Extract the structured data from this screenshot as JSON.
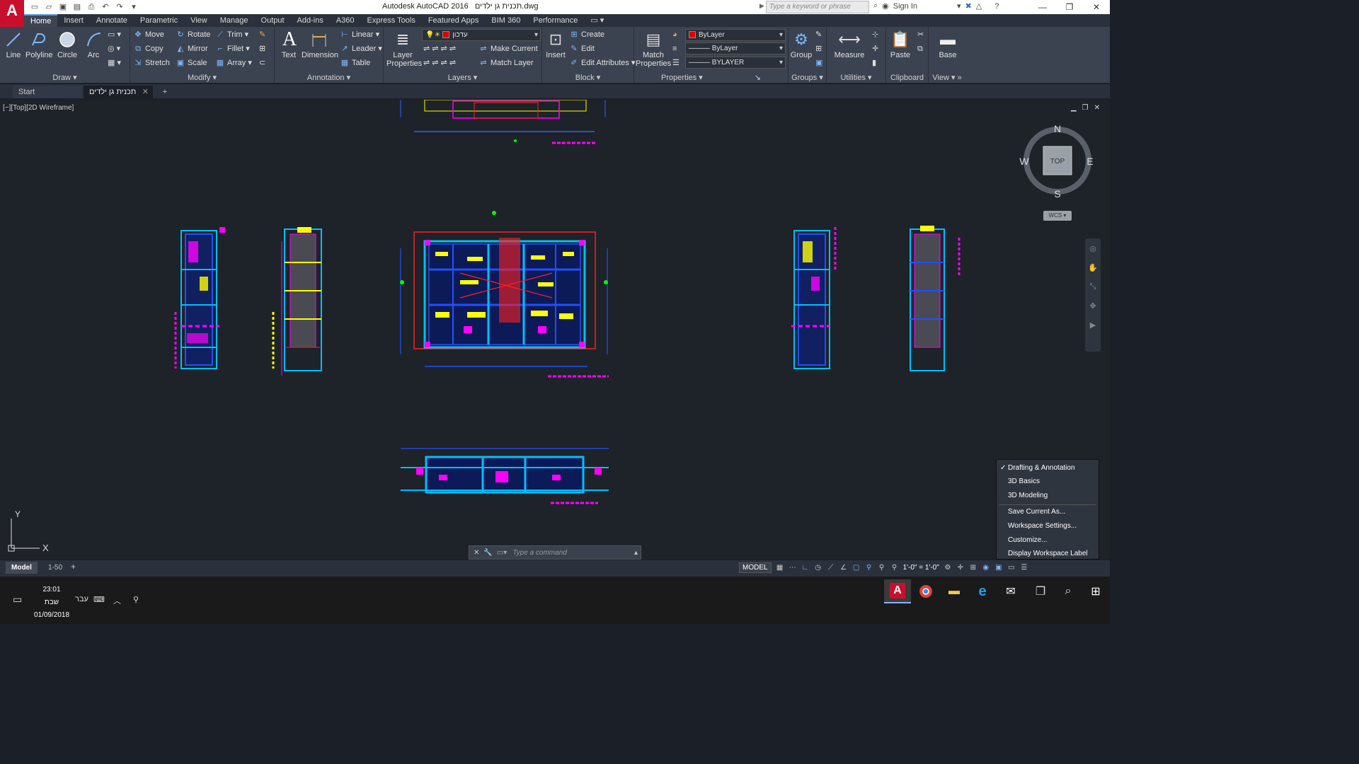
{
  "app": {
    "title": "Autodesk AutoCAD 2016",
    "filename": "תכנית גן ילדים.dwg",
    "logo": "A",
    "search_placeholder": "Type a keyword or phrase",
    "sign_in": "Sign In"
  },
  "menu_tabs": [
    "Home",
    "Insert",
    "Annotate",
    "Parametric",
    "View",
    "Manage",
    "Output",
    "Add-ins",
    "A360",
    "Express Tools",
    "Featured Apps",
    "BIM 360",
    "Performance"
  ],
  "ribbon": {
    "draw": {
      "title": "Draw",
      "line": "Line",
      "polyline": "Polyline",
      "circle": "Circle",
      "arc": "Arc"
    },
    "modify": {
      "title": "Modify",
      "move": "Move",
      "rotate": "Rotate",
      "trim": "Trim",
      "copy": "Copy",
      "mirror": "Mirror",
      "fillet": "Fillet",
      "stretch": "Stretch",
      "scale": "Scale",
      "array": "Array"
    },
    "annotation": {
      "title": "Annotation",
      "text": "Text",
      "dimension": "Dimension",
      "linear": "Linear",
      "leader": "Leader",
      "table": "Table"
    },
    "layers": {
      "title": "Layers",
      "layer_properties_1": "Layer",
      "layer_properties_2": "Properties",
      "current_layer": "עדכון",
      "make_current": "Make Current",
      "match_layer": "Match Layer"
    },
    "block": {
      "title": "Block",
      "insert": "Insert",
      "create": "Create",
      "edit": "Edit",
      "edit_attributes": "Edit Attributes"
    },
    "properties": {
      "title": "Properties",
      "match_1": "Match",
      "match_2": "Properties",
      "color": "ByLayer",
      "linetype": "ByLayer",
      "lineweight": "BYLAYER"
    },
    "groups": {
      "title": "Groups",
      "group": "Group"
    },
    "utilities": {
      "title": "Utilities",
      "measure": "Measure"
    },
    "clipboard": {
      "title": "Clipboard",
      "paste": "Paste"
    },
    "view": {
      "title": "View",
      "base": "Base"
    }
  },
  "doc_tabs": {
    "start": "Start",
    "file": "תכנית גן ילדים"
  },
  "viewport": {
    "label": "[−][Top][2D Wireframe]",
    "viewcube": {
      "n": "N",
      "s": "S",
      "e": "E",
      "w": "W",
      "face": "TOP"
    },
    "wcs": "WCS ▾",
    "ucs_x": "X",
    "ucs_y": "Y"
  },
  "command": {
    "placeholder": "Type a command"
  },
  "workspace_menu": {
    "items": [
      "Drafting & Annotation",
      "3D Basics",
      "3D Modeling",
      "Save Current As...",
      "Workspace Settings...",
      "Customize...",
      "Display Workspace Label"
    ],
    "checked": "Drafting & Annotation"
  },
  "status": {
    "layout_model": "Model",
    "layout_sheet": "1-50",
    "model_button": "MODEL",
    "scale": "1'-0\" = 1'-0\""
  },
  "taskbar": {
    "time": "23:01",
    "day": "שבת",
    "date": "01/09/2018",
    "lang": "עבר"
  },
  "colors": {
    "accent": "#5b9bd5",
    "brand": "#c8102e",
    "ribbon_bg": "#3b4350",
    "canvas_bg": "#1e2229"
  }
}
